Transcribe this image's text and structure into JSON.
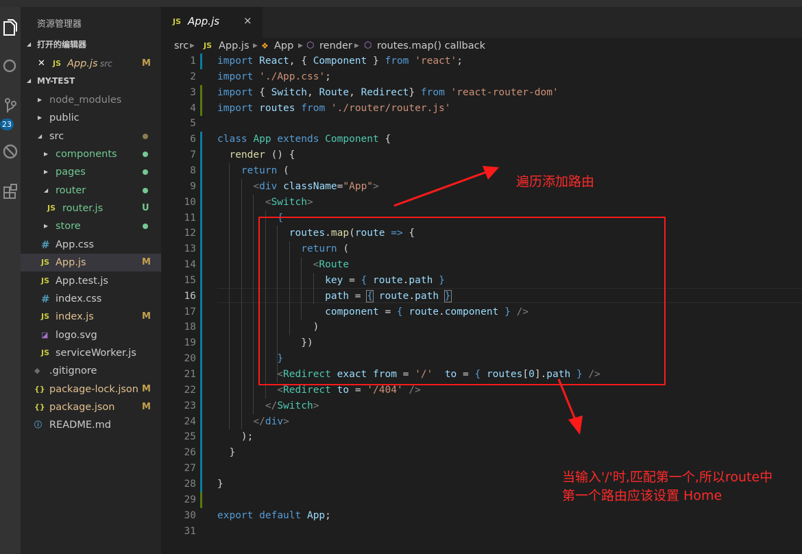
{
  "sidebar": {
    "title": "资源管理器",
    "open_editors_label": "打开的编辑器",
    "open_file": {
      "name": "App.js",
      "folder": "src",
      "flag": "M"
    },
    "project_label": "MY-TEST",
    "tree": [
      {
        "name": "node_modules",
        "type": "folder",
        "depth": 0,
        "expanded": false,
        "color": "#8c8c8c"
      },
      {
        "name": "public",
        "type": "folder",
        "depth": 0,
        "expanded": false,
        "color": "#cccccc"
      },
      {
        "name": "src",
        "type": "folder",
        "depth": 0,
        "expanded": true,
        "color": "#cccccc",
        "dot": "#8c7b52"
      },
      {
        "name": "components",
        "type": "folder",
        "depth": 1,
        "expanded": false,
        "color": "#73c991",
        "dot": "#73c991"
      },
      {
        "name": "pages",
        "type": "folder",
        "depth": 1,
        "expanded": false,
        "color": "#73c991",
        "dot": "#73c991"
      },
      {
        "name": "router",
        "type": "folder",
        "depth": 1,
        "expanded": true,
        "color": "#73c991",
        "dot": "#73c991"
      },
      {
        "name": "router.js",
        "type": "js",
        "depth": 2,
        "color": "#73c991",
        "flag": "U",
        "flag_color": "#73c991"
      },
      {
        "name": "store",
        "type": "folder",
        "depth": 1,
        "expanded": false,
        "color": "#73c991",
        "dot": "#73c991"
      },
      {
        "name": "App.css",
        "type": "css",
        "depth": 1,
        "color": "#cccccc"
      },
      {
        "name": "App.js",
        "type": "js",
        "depth": 1,
        "color": "#e2c08d",
        "flag": "M",
        "flag_color": "#c4a14e",
        "selected": true
      },
      {
        "name": "App.test.js",
        "type": "js",
        "depth": 1,
        "color": "#cccccc"
      },
      {
        "name": "index.css",
        "type": "css",
        "depth": 1,
        "color": "#cccccc"
      },
      {
        "name": "index.js",
        "type": "js",
        "depth": 1,
        "color": "#e2c08d",
        "flag": "M",
        "flag_color": "#c4a14e"
      },
      {
        "name": "logo.svg",
        "type": "svg",
        "depth": 1,
        "color": "#cccccc"
      },
      {
        "name": "serviceWorker.js",
        "type": "js",
        "depth": 1,
        "color": "#cccccc"
      },
      {
        "name": ".gitignore",
        "type": "git",
        "depth": 0,
        "color": "#cccccc"
      },
      {
        "name": "package-lock.json",
        "type": "json",
        "depth": 0,
        "color": "#e2c08d",
        "flag": "M",
        "flag_color": "#c4a14e"
      },
      {
        "name": "package.json",
        "type": "json",
        "depth": 0,
        "color": "#e2c08d",
        "flag": "M",
        "flag_color": "#c4a14e"
      },
      {
        "name": "README.md",
        "type": "info",
        "depth": 0,
        "color": "#cccccc"
      }
    ]
  },
  "activity": {
    "badge": "23"
  },
  "tab": {
    "label": "App.js",
    "icon": "JS",
    "close": "×"
  },
  "breadcrumb": [
    "src",
    "App.js",
    "App",
    "render",
    "routes.map() callback"
  ],
  "editor": {
    "current_line": 16,
    "lines": [
      [
        [
          "k",
          "import"
        ],
        [
          "p",
          " "
        ],
        [
          "v",
          "React"
        ],
        [
          "p",
          ", { "
        ],
        [
          "v",
          "Component"
        ],
        [
          "p",
          " } "
        ],
        [
          "k",
          "from"
        ],
        [
          "p",
          " "
        ],
        [
          "s",
          "'react'"
        ],
        [
          "p",
          ";"
        ]
      ],
      [
        [
          "k",
          "import"
        ],
        [
          "p",
          " "
        ],
        [
          "s",
          "'./App.css'"
        ],
        [
          "p",
          ";"
        ]
      ],
      [
        [
          "k",
          "import"
        ],
        [
          "p",
          " { "
        ],
        [
          "v",
          "Switch"
        ],
        [
          "p",
          ", "
        ],
        [
          "v",
          "Route"
        ],
        [
          "p",
          ", "
        ],
        [
          "v",
          "Redirect"
        ],
        [
          "p",
          "} "
        ],
        [
          "k",
          "from"
        ],
        [
          "p",
          " "
        ],
        [
          "s",
          "'react-router-dom'"
        ]
      ],
      [
        [
          "k",
          "import"
        ],
        [
          "p",
          " "
        ],
        [
          "v",
          "routes"
        ],
        [
          "p",
          " "
        ],
        [
          "k",
          "from"
        ],
        [
          "p",
          " "
        ],
        [
          "s",
          "'./router/router.js'"
        ]
      ],
      [],
      [
        [
          "k",
          "class"
        ],
        [
          "p",
          " "
        ],
        [
          "c",
          "App"
        ],
        [
          "p",
          " "
        ],
        [
          "k",
          "extends"
        ],
        [
          "p",
          " "
        ],
        [
          "c",
          "Component"
        ],
        [
          "p",
          " {"
        ]
      ],
      [
        [
          "p",
          "  "
        ],
        [
          "f",
          "render"
        ],
        [
          "p",
          " () {"
        ]
      ],
      [
        [
          "p",
          "    "
        ],
        [
          "k",
          "return"
        ],
        [
          "p",
          " ("
        ]
      ],
      [
        [
          "p",
          "      "
        ],
        [
          "tg",
          "<"
        ],
        [
          "k",
          "div"
        ],
        [
          "p",
          " "
        ],
        [
          "v",
          "className"
        ],
        [
          "p",
          "="
        ],
        [
          "s",
          "\"App\""
        ],
        [
          "tg",
          ">"
        ]
      ],
      [
        [
          "p",
          "        "
        ],
        [
          "tg",
          "<"
        ],
        [
          "c",
          "Switch"
        ],
        [
          "tg",
          ">"
        ]
      ],
      [
        [
          "p",
          "          "
        ],
        [
          "k",
          "{"
        ]
      ],
      [
        [
          "p",
          "            "
        ],
        [
          "v",
          "routes"
        ],
        [
          "p",
          "."
        ],
        [
          "f",
          "map"
        ],
        [
          "p",
          "("
        ],
        [
          "v",
          "route"
        ],
        [
          "p",
          " "
        ],
        [
          "k",
          "=>"
        ],
        [
          "p",
          " {"
        ]
      ],
      [
        [
          "p",
          "              "
        ],
        [
          "k",
          "return"
        ],
        [
          "p",
          " ("
        ]
      ],
      [
        [
          "p",
          "                "
        ],
        [
          "tg",
          "<"
        ],
        [
          "c",
          "Route"
        ]
      ],
      [
        [
          "p",
          "                  "
        ],
        [
          "v",
          "key"
        ],
        [
          "p",
          " = "
        ],
        [
          "k",
          "{"
        ],
        [
          "p",
          " "
        ],
        [
          "v",
          "route"
        ],
        [
          "p",
          "."
        ],
        [
          "v",
          "path"
        ],
        [
          "p",
          " "
        ],
        [
          "k",
          "}"
        ]
      ],
      [
        [
          "p",
          "                  "
        ],
        [
          "v",
          "path"
        ],
        [
          "p",
          " = "
        ],
        [
          "kb",
          "{"
        ],
        [
          "p",
          " "
        ],
        [
          "v",
          "route"
        ],
        [
          "p",
          "."
        ],
        [
          "v",
          "path"
        ],
        [
          "p",
          " "
        ],
        [
          "kb",
          "}"
        ]
      ],
      [
        [
          "p",
          "                  "
        ],
        [
          "v",
          "component"
        ],
        [
          "p",
          " = "
        ],
        [
          "k",
          "{"
        ],
        [
          "p",
          " "
        ],
        [
          "v",
          "route"
        ],
        [
          "p",
          "."
        ],
        [
          "v",
          "component"
        ],
        [
          "p",
          " "
        ],
        [
          "k",
          "}"
        ],
        [
          "p",
          " "
        ],
        [
          "tg",
          "/>"
        ]
      ],
      [
        [
          "p",
          "                )"
        ]
      ],
      [
        [
          "p",
          "              })"
        ]
      ],
      [
        [
          "p",
          "          "
        ],
        [
          "k",
          "}"
        ]
      ],
      [
        [
          "p",
          "          "
        ],
        [
          "tg",
          "<"
        ],
        [
          "c",
          "Redirect"
        ],
        [
          "p",
          " "
        ],
        [
          "v",
          "exact"
        ],
        [
          "p",
          " "
        ],
        [
          "v",
          "from"
        ],
        [
          "p",
          " = "
        ],
        [
          "s",
          "'/'"
        ],
        [
          "p",
          "  "
        ],
        [
          "v",
          "to"
        ],
        [
          "p",
          " = "
        ],
        [
          "k",
          "{"
        ],
        [
          "p",
          " "
        ],
        [
          "v",
          "routes"
        ],
        [
          "p",
          "["
        ],
        [
          "v",
          "0"
        ],
        [
          "p",
          "]."
        ],
        [
          "v",
          "path"
        ],
        [
          "p",
          " "
        ],
        [
          "k",
          "}"
        ],
        [
          "p",
          " "
        ],
        [
          "tg",
          "/>"
        ]
      ],
      [
        [
          "p",
          "          "
        ],
        [
          "tg",
          "<"
        ],
        [
          "c",
          "Redirect"
        ],
        [
          "p",
          " "
        ],
        [
          "v",
          "to"
        ],
        [
          "p",
          " = "
        ],
        [
          "s",
          "'/404'"
        ],
        [
          "p",
          " "
        ],
        [
          "tg",
          "/>"
        ]
      ],
      [
        [
          "p",
          "        "
        ],
        [
          "tg",
          "</"
        ],
        [
          "c",
          "Switch"
        ],
        [
          "tg",
          ">"
        ]
      ],
      [
        [
          "p",
          "      "
        ],
        [
          "tg",
          "</"
        ],
        [
          "k",
          "div"
        ],
        [
          "tg",
          ">"
        ]
      ],
      [
        [
          "p",
          "    );"
        ]
      ],
      [
        [
          "p",
          "  }"
        ]
      ],
      [],
      [
        [
          "p",
          "}"
        ]
      ],
      [],
      [
        [
          "k",
          "export"
        ],
        [
          "p",
          " "
        ],
        [
          "k",
          "default"
        ],
        [
          "p",
          " "
        ],
        [
          "v",
          "App"
        ],
        [
          "p",
          ";"
        ]
      ],
      []
    ]
  },
  "annotations": {
    "note1": "遍历添加路由",
    "note2_line1": "当输入'/'时,匹配第一个,所以route中",
    "note2_line2": "第一个路由应该设置 Home"
  }
}
